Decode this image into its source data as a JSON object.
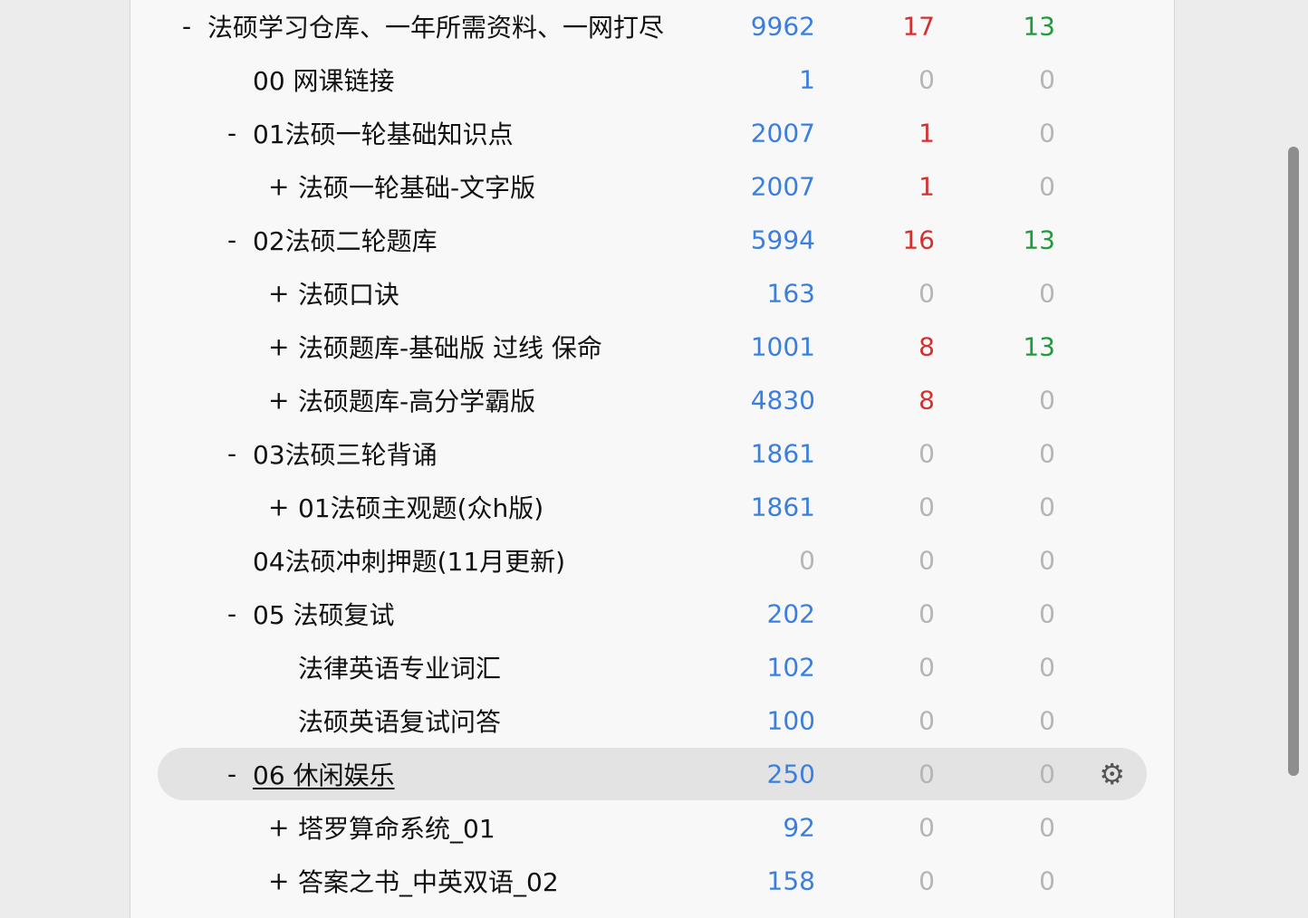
{
  "colors": {
    "new": "#3b7fde",
    "learn": "#d3302f",
    "review": "#1f9a3c",
    "zero": "#b5b5b5"
  },
  "decks": [
    {
      "toggle": "-",
      "name": "法硕学习仓库、一年所需资料、一网打尽",
      "new": "9962",
      "learn": "17",
      "review": "13"
    },
    {
      "toggle": "",
      "name": "00 网课链接",
      "new": "1",
      "learn": "0",
      "review": "0"
    },
    {
      "toggle": "-",
      "name": "01法硕一轮基础知识点",
      "new": "2007",
      "learn": "1",
      "review": "0"
    },
    {
      "toggle": "+",
      "name": "法硕一轮基础-文字版",
      "new": "2007",
      "learn": "1",
      "review": "0"
    },
    {
      "toggle": "-",
      "name": "02法硕二轮题库",
      "new": "5994",
      "learn": "16",
      "review": "13"
    },
    {
      "toggle": "+",
      "name": "法硕口诀",
      "new": "163",
      "learn": "0",
      "review": "0"
    },
    {
      "toggle": "+",
      "name": "法硕题库-基础版 过线 保命",
      "new": "1001",
      "learn": "8",
      "review": "13"
    },
    {
      "toggle": "+",
      "name": "法硕题库-高分学霸版",
      "new": "4830",
      "learn": "8",
      "review": "0"
    },
    {
      "toggle": "-",
      "name": "03法硕三轮背诵",
      "new": "1861",
      "learn": "0",
      "review": "0"
    },
    {
      "toggle": "+",
      "name": "01法硕主观题(众h版)",
      "new": "1861",
      "learn": "0",
      "review": "0"
    },
    {
      "toggle": "",
      "name": "04法硕冲刺押题(11月更新)",
      "new": "0",
      "learn": "0",
      "review": "0"
    },
    {
      "toggle": "-",
      "name": "05 法硕复试",
      "new": "202",
      "learn": "0",
      "review": "0"
    },
    {
      "toggle": "",
      "name": "法律英语专业词汇",
      "new": "102",
      "learn": "0",
      "review": "0"
    },
    {
      "toggle": "",
      "name": "法硕英语复试问答",
      "new": "100",
      "learn": "0",
      "review": "0"
    },
    {
      "toggle": "-",
      "name": "06 休闲娱乐",
      "new": "250",
      "learn": "0",
      "review": "0",
      "current": true
    },
    {
      "toggle": "+",
      "name": "塔罗算命系统_01",
      "new": "92",
      "learn": "0",
      "review": "0"
    },
    {
      "toggle": "+",
      "name": "答案之书_中英双语_02",
      "new": "158",
      "learn": "0",
      "review": "0"
    }
  ],
  "gear_icon": "gear-icon"
}
